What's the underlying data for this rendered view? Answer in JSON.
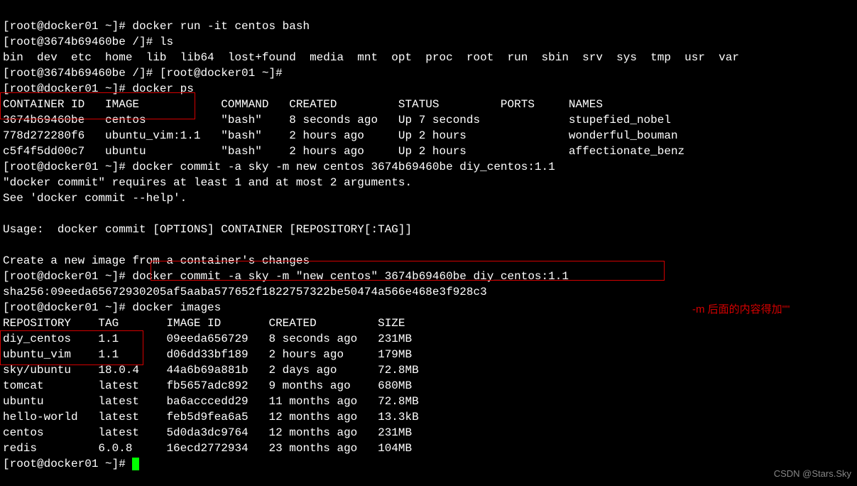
{
  "lines": {
    "l1": "[root@docker01 ~]# docker run -it centos bash",
    "l2": "[root@3674b69460be /]# ls",
    "l3": "bin  dev  etc  home  lib  lib64  lost+found  media  mnt  opt  proc  root  run  sbin  srv  sys  tmp  usr  var",
    "l4": "[root@3674b69460be /]# [root@docker01 ~]#",
    "l5": "[root@docker01 ~]# docker ps",
    "l6": "CONTAINER ID   IMAGE            COMMAND   CREATED         STATUS         PORTS     NAMES",
    "l7": "3674b69460be   centos           \"bash\"    8 seconds ago   Up 7 seconds             stupefied_nobel",
    "l8": "778d272280f6   ubuntu_vim:1.1   \"bash\"    2 hours ago     Up 2 hours               wonderful_bouman",
    "l9": "c5f4f5dd00c7   ubuntu           \"bash\"    2 hours ago     Up 2 hours               affectionate_benz",
    "l10": "[root@docker01 ~]# docker commit -a sky -m new centos 3674b69460be diy_centos:1.1",
    "l11": "\"docker commit\" requires at least 1 and at most 2 arguments.",
    "l12": "See 'docker commit --help'.",
    "l13": "",
    "l14": "Usage:  docker commit [OPTIONS] CONTAINER [REPOSITORY[:TAG]]",
    "l15": "",
    "l16": "Create a new image from a container's changes",
    "l17": "[root@docker01 ~]# docker commit -a sky -m \"new centos\" 3674b69460be diy_centos:1.1",
    "l18": "sha256:09eeda65672930205af5aaba577652f1822757322be50474a566e468e3f928c3",
    "l19": "[root@docker01 ~]# docker images",
    "l20": "REPOSITORY    TAG       IMAGE ID       CREATED         SIZE",
    "l21": "diy_centos    1.1       09eeda656729   8 seconds ago   231MB",
    "l22": "ubuntu_vim    1.1       d06dd33bf189   2 hours ago     179MB",
    "l23": "sky/ubuntu    18.0.4    44a6b69a881b   2 days ago      72.8MB",
    "l24": "tomcat        latest    fb5657adc892   9 months ago    680MB",
    "l25": "ubuntu        latest    ba6acccedd29   11 months ago   72.8MB",
    "l26": "hello-world   latest    feb5d9fea6a5   12 months ago   13.3kB",
    "l27": "centos        latest    5d0da3dc9764   12 months ago   231MB",
    "l28": "redis         6.0.8     16ecd2772934   23 months ago   104MB",
    "l29": "[root@docker01 ~]# "
  },
  "annotation": "-m 后面的内容得加\"\"",
  "watermark": "CSDN @Stars.Sky",
  "docker_ps": {
    "headers": [
      "CONTAINER ID",
      "IMAGE",
      "COMMAND",
      "CREATED",
      "STATUS",
      "PORTS",
      "NAMES"
    ],
    "rows": [
      {
        "id": "3674b69460be",
        "image": "centos",
        "command": "\"bash\"",
        "created": "8 seconds ago",
        "status": "Up 7 seconds",
        "ports": "",
        "names": "stupefied_nobel"
      },
      {
        "id": "778d272280f6",
        "image": "ubuntu_vim:1.1",
        "command": "\"bash\"",
        "created": "2 hours ago",
        "status": "Up 2 hours",
        "ports": "",
        "names": "wonderful_bouman"
      },
      {
        "id": "c5f4f5dd00c7",
        "image": "ubuntu",
        "command": "\"bash\"",
        "created": "2 hours ago",
        "status": "Up 2 hours",
        "ports": "",
        "names": "affectionate_benz"
      }
    ]
  },
  "docker_images": {
    "headers": [
      "REPOSITORY",
      "TAG",
      "IMAGE ID",
      "CREATED",
      "SIZE"
    ],
    "rows": [
      {
        "repository": "diy_centos",
        "tag": "1.1",
        "image_id": "09eeda656729",
        "created": "8 seconds ago",
        "size": "231MB"
      },
      {
        "repository": "ubuntu_vim",
        "tag": "1.1",
        "image_id": "d06dd33bf189",
        "created": "2 hours ago",
        "size": "179MB"
      },
      {
        "repository": "sky/ubuntu",
        "tag": "18.0.4",
        "image_id": "44a6b69a881b",
        "created": "2 days ago",
        "size": "72.8MB"
      },
      {
        "repository": "tomcat",
        "tag": "latest",
        "image_id": "fb5657adc892",
        "created": "9 months ago",
        "size": "680MB"
      },
      {
        "repository": "ubuntu",
        "tag": "latest",
        "image_id": "ba6acccedd29",
        "created": "11 months ago",
        "size": "72.8MB"
      },
      {
        "repository": "hello-world",
        "tag": "latest",
        "image_id": "feb5d9fea6a5",
        "created": "12 months ago",
        "size": "13.3kB"
      },
      {
        "repository": "centos",
        "tag": "latest",
        "image_id": "5d0da3dc9764",
        "created": "12 months ago",
        "size": "231MB"
      },
      {
        "repository": "redis",
        "tag": "6.0.8",
        "image_id": "16ecd2772934",
        "created": "23 months ago",
        "size": "104MB"
      }
    ]
  }
}
